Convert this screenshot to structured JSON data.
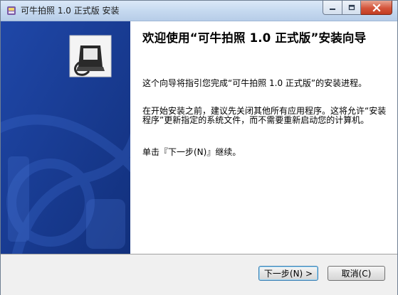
{
  "window": {
    "title": "可牛拍照 1.0 正式版 安装"
  },
  "colors": {
    "sidebar": "#1b3f9b",
    "footer": "#f0f0f0",
    "close_button": "#d4553b"
  },
  "icons": [
    "installer-app-icon",
    "minimize-icon",
    "maximize-icon",
    "close-icon",
    "installer-logo-icon"
  ],
  "content": {
    "title": "欢迎使用“可牛拍照 1.0 正式版”安装向导",
    "paragraph1": "这个向导将指引您完成“可牛拍照 1.0 正式版”的安装进程。",
    "paragraph2": "在开始安装之前，建议先关闭其他所有应用程序。这将允许“安装程序”更新指定的系统文件，而不需要重新启动您的计算机。",
    "paragraph3": "单击『下一步(N)』继续。"
  },
  "buttons": {
    "next": "下一步(N) >",
    "cancel": "取消(C)"
  }
}
